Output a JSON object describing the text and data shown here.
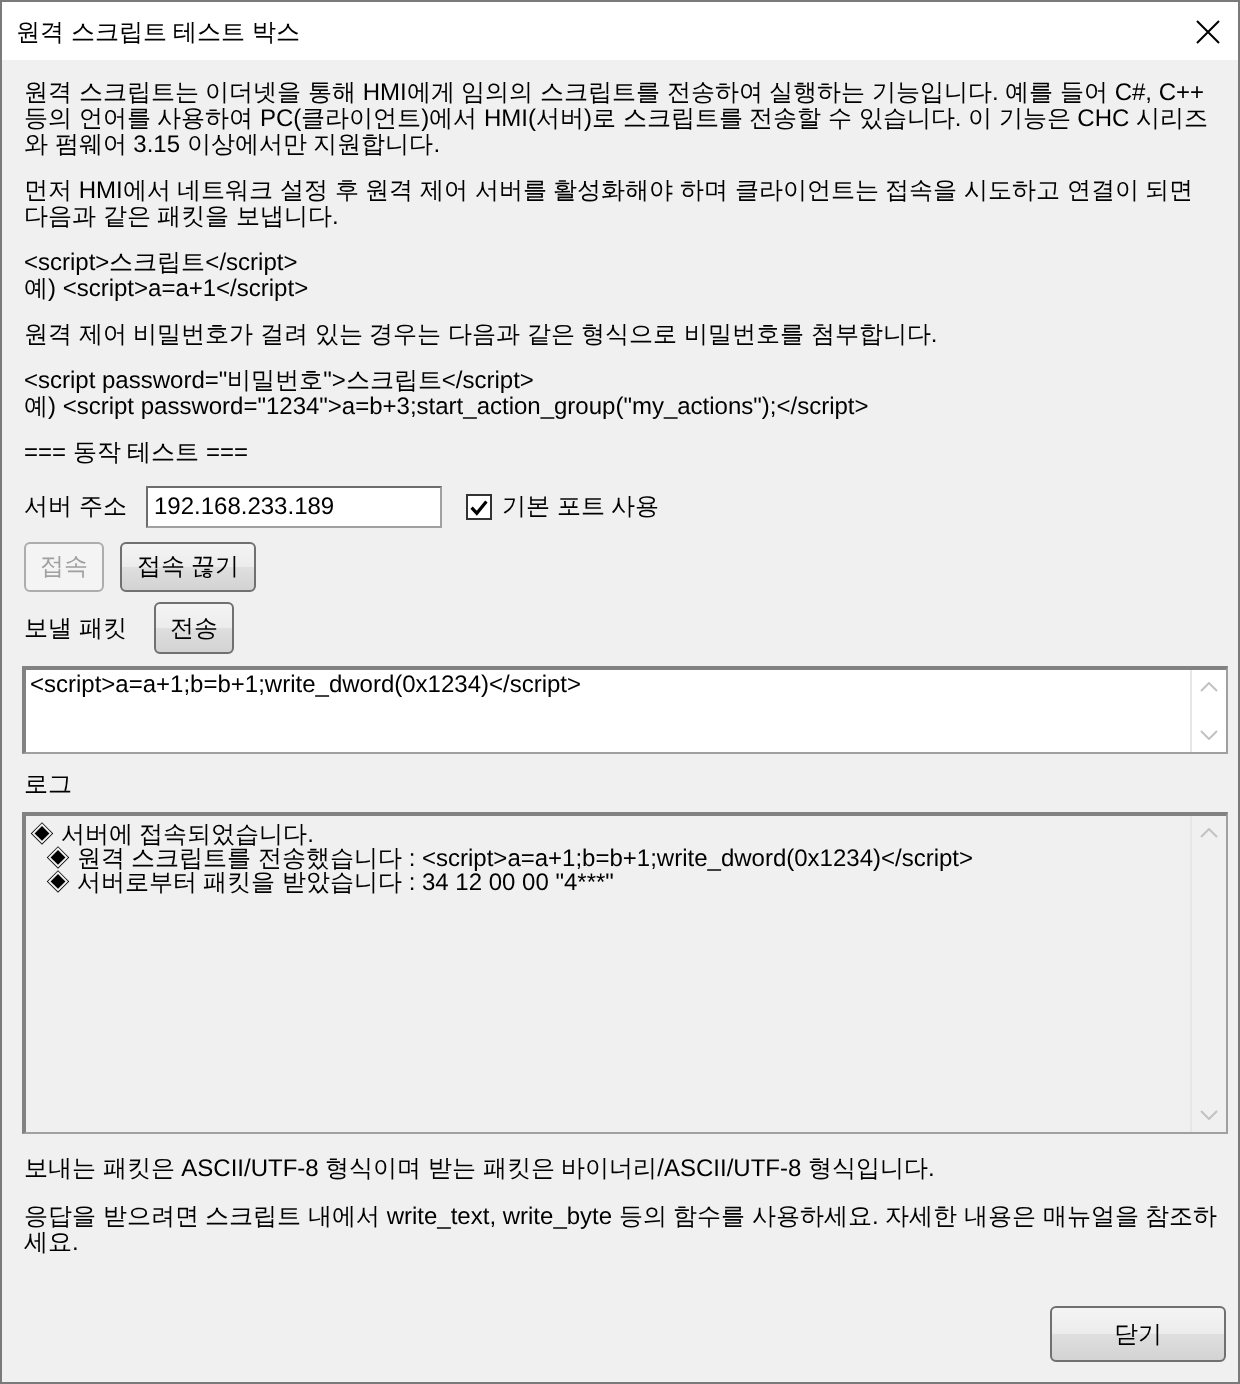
{
  "window": {
    "title": "원격 스크립트 테스트 박스"
  },
  "description": [
    {
      "lines": [
        "원격 스크립트는 이더넷을 통해 HMI에게 임의의 스크립트를 전송하여 실행하는 기능입니다. 예를 들어 C#, C++ 등의 언어를 사용하여 PC(클라이언트)에서 HMI(서버)로 스크립트를 전송할 수 있습니다. 이 기능은 CHC 시리즈와 펌웨어 3.15 이상에서만 지원합니다."
      ]
    },
    {
      "lines": [
        "먼저 HMI에서 네트워크 설정 후 원격 제어 서버를 활성화해야 하며 클라이언트는 접속을 시도하고 연결이 되면 다음과 같은 패킷을 보냅니다."
      ]
    },
    {
      "lines": [
        "<script>스크립트</script>",
        "예) <script>a=a+1</script>"
      ]
    },
    {
      "lines": [
        "원격 제어 비밀번호가 걸려 있는 경우는 다음과 같은 형식으로 비밀번호를 첨부합니다."
      ]
    },
    {
      "lines": [
        "<script password=\"비밀번호\">스크립트</script>",
        "예) <script password=\"1234\">a=b+3;start_action_group(\"my_actions\");</script>"
      ]
    }
  ],
  "section_title": "=== 동작 테스트 ===",
  "server": {
    "label": "서버 주소",
    "value": "192.168.233.189",
    "default_port": {
      "label": "기본 포트 사용",
      "checked": true
    }
  },
  "connection_buttons": [
    {
      "label": "접속",
      "disabled": true
    },
    {
      "label": "접속 끊기",
      "disabled": false
    }
  ],
  "packet": {
    "label": "보낼 패킷",
    "send_button": {
      "label": "전송"
    },
    "value": "<script>a=a+1;b=b+1;write_dword(0x1234)</script>"
  },
  "log": {
    "label": "로그",
    "entries": [
      {
        "text": "◈ 서버에 접속되었습니다.",
        "children": [
          {
            "text": "◈ 원격 스크립트를 전송했습니다 : <script>a=a+1;b=b+1;write_dword(0x1234)</script>"
          },
          {
            "text": "◈ 서버로부터 패킷을 받았습니다 : 34 12 00 00 \"4***\""
          }
        ]
      }
    ]
  },
  "notes": [
    "보내는 패킷은 ASCII/UTF-8 형식이며 받는 패킷은 바이너리/ASCII/UTF-8 형식입니다.",
    "응답을 받으려면 스크립트 내에서 write_text, write_byte 등의 함수를 사용하세요. 자세한 내용은 매뉴얼을 참조하세요."
  ],
  "close_button": {
    "label": "닫기"
  }
}
